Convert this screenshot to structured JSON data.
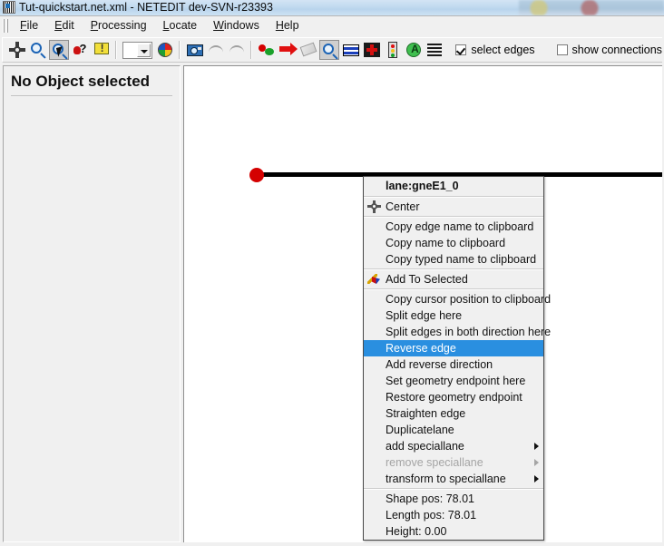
{
  "window": {
    "title": "Tut-quickstart.net.xml - NETEDIT dev-SVN-r23393",
    "icon": "netedit-app-icon"
  },
  "menubar": {
    "items": [
      {
        "label": "File",
        "mnemonic": "F"
      },
      {
        "label": "Edit",
        "mnemonic": "E"
      },
      {
        "label": "Processing",
        "mnemonic": "P"
      },
      {
        "label": "Locate",
        "mnemonic": "L"
      },
      {
        "label": "Windows",
        "mnemonic": "W"
      },
      {
        "label": "Help",
        "mnemonic": "H"
      }
    ]
  },
  "toolbar": {
    "buttons": [
      {
        "name": "recenter-view-icon",
        "kind": "pan"
      },
      {
        "name": "zoom-style-icon",
        "kind": "mag"
      },
      {
        "name": "zoom-select-icon",
        "kind": "magcursor",
        "pressed": true
      },
      {
        "name": "show-tooltips-icon",
        "kind": "help"
      },
      {
        "name": "edit-viewport-icon",
        "kind": "bubble"
      }
    ],
    "combo_value": "",
    "buttons2": [
      {
        "name": "colorscheme-icon",
        "kind": "colorwheel"
      },
      {
        "name": "make-snapshot-icon",
        "kind": "camera"
      },
      {
        "name": "undo-icon",
        "kind": "undo"
      },
      {
        "name": "redo-icon",
        "kind": "redo"
      }
    ],
    "buttons3": [
      {
        "name": "create-edge-mode-icon",
        "kind": "dotline"
      },
      {
        "name": "move-mode-icon",
        "kind": "redarrow"
      },
      {
        "name": "delete-mode-icon",
        "kind": "eraser"
      },
      {
        "name": "inspect-mode-icon",
        "kind": "magselect",
        "pressed": true
      },
      {
        "name": "select-mode-icon",
        "kind": "lanes"
      },
      {
        "name": "connect-mode-icon",
        "kind": "junction"
      },
      {
        "name": "traffic-light-mode-icon",
        "kind": "tls"
      },
      {
        "name": "additionals-mode-icon",
        "kind": "additional"
      },
      {
        "name": "crossing-mode-icon",
        "kind": "list"
      }
    ],
    "checkboxes": [
      {
        "label": "select edges",
        "checked": true
      },
      {
        "label": "show connections",
        "checked": false
      }
    ]
  },
  "left_panel": {
    "header": "No Object selected"
  },
  "canvas": {
    "edge_node_color": "#d40000",
    "edge_color": "#000000"
  },
  "context_menu": {
    "title": "lane:gneE1_0",
    "groups": [
      {
        "items": [
          {
            "label": "Center",
            "icon": "center-icon",
            "type": "item"
          }
        ]
      },
      {
        "items": [
          {
            "label": "Copy edge name to clipboard",
            "type": "item"
          },
          {
            "label": "Copy name to clipboard",
            "type": "item"
          },
          {
            "label": "Copy typed name to clipboard",
            "type": "item"
          }
        ]
      },
      {
        "items": [
          {
            "label": "Add To Selected",
            "icon": "add-to-selected-icon",
            "type": "item"
          }
        ]
      },
      {
        "items": [
          {
            "label": "Copy cursor position to clipboard",
            "type": "item"
          },
          {
            "label": "Split edge here",
            "type": "item"
          },
          {
            "label": "Split edges in both direction here",
            "type": "item"
          },
          {
            "label": "Reverse edge",
            "type": "item",
            "highlighted": true
          },
          {
            "label": "Add reverse direction",
            "type": "item"
          },
          {
            "label": "Set geometry endpoint here",
            "type": "item"
          },
          {
            "label": "Restore geometry endpoint",
            "type": "item"
          },
          {
            "label": "Straighten edge",
            "type": "item"
          },
          {
            "label": "Duplicatelane",
            "type": "item"
          },
          {
            "label": "add speciallane",
            "type": "submenu"
          },
          {
            "label": "remove speciallane",
            "type": "submenu",
            "disabled": true
          },
          {
            "label": "transform to speciallane",
            "type": "submenu"
          }
        ]
      },
      {
        "items": [
          {
            "label": "Shape pos: 78.01",
            "type": "info"
          },
          {
            "label": "Length pos: 78.01",
            "type": "info"
          },
          {
            "label": "Height: 0.00",
            "type": "info"
          }
        ]
      }
    ]
  },
  "colors": {
    "highlight": "#2a8fe0",
    "chrome": "#f0f0f0",
    "node": "#d40000"
  }
}
